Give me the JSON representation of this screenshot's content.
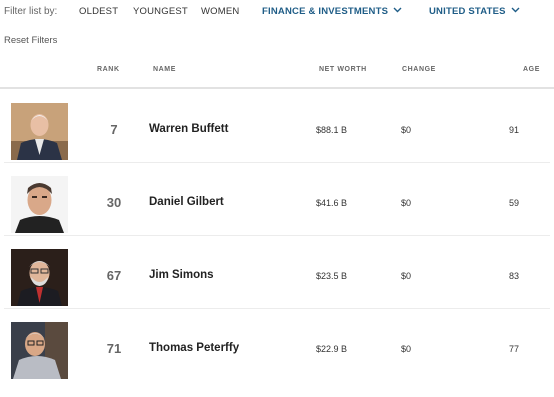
{
  "filters": {
    "label": "Filter list by:",
    "oldest": "OLDEST",
    "youngest": "YOUNGEST",
    "women": "WOMEN",
    "industry": "FINANCE & INVESTMENTS",
    "country": "UNITED STATES",
    "reset": "Reset Filters"
  },
  "columns": {
    "rank": "RANK",
    "name": "NAME",
    "net_worth": "NET WORTH",
    "change": "CHANGE",
    "age": "AGE"
  },
  "rows": [
    {
      "rank": "7",
      "name": "Warren Buffett",
      "net_worth": "$88.1 B",
      "change": "$0",
      "age": "91"
    },
    {
      "rank": "30",
      "name": "Daniel Gilbert",
      "net_worth": "$41.6 B",
      "change": "$0",
      "age": "59"
    },
    {
      "rank": "67",
      "name": "Jim Simons",
      "net_worth": "$23.5 B",
      "change": "$0",
      "age": "83"
    },
    {
      "rank": "71",
      "name": "Thomas Peterffy",
      "net_worth": "$22.9 B",
      "change": "$0",
      "age": "77"
    }
  ],
  "colors": {
    "accent": "#1f5d87",
    "header_text": "#666666",
    "divider": "#e2e2e2"
  }
}
